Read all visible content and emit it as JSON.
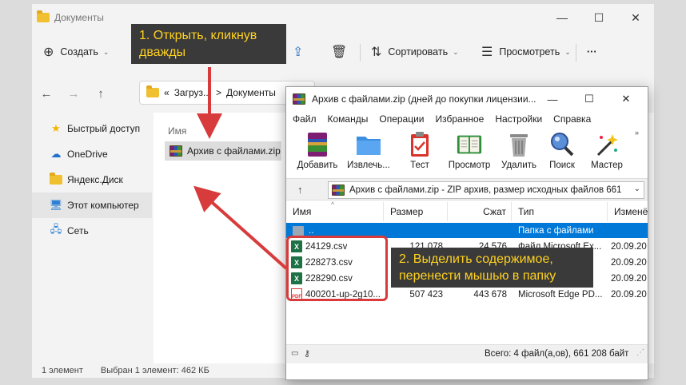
{
  "explorer": {
    "title": "Документы",
    "window_controls": {
      "minimize": "—",
      "maximize": "☐",
      "close": "✕"
    },
    "toolbar": {
      "new_label": "Создать",
      "sort_label": "Сортировать",
      "view_label": "Просмотреть",
      "more_label": "···"
    },
    "breadcrumb": {
      "prefix": "«",
      "part1": "Загруз...",
      "sep": ">",
      "part2": "Документы"
    },
    "sidebar": [
      {
        "label": "Быстрый доступ",
        "icon": "star-icon"
      },
      {
        "label": "OneDrive",
        "icon": "cloud-icon"
      },
      {
        "label": "Яндекс.Диск",
        "icon": "yandex-disk-icon"
      },
      {
        "label": "Этот компьютер",
        "icon": "computer-icon"
      },
      {
        "label": "Сеть",
        "icon": "network-icon"
      }
    ],
    "column_name": "Имя",
    "file_name": "Архив с файлами.zip",
    "status_count": "1 элемент",
    "status_selected": "Выбран 1 элемент: 462 КБ"
  },
  "winrar": {
    "title": "Архив с файлами.zip (дней до покупки лицензии...",
    "menu": [
      "Файл",
      "Команды",
      "Операции",
      "Избранное",
      "Настройки",
      "Справка"
    ],
    "tools": [
      {
        "label": "Добавить",
        "icon": "add-archive-icon"
      },
      {
        "label": "Извлечь...",
        "icon": "extract-icon"
      },
      {
        "label": "Тест",
        "icon": "test-icon"
      },
      {
        "label": "Просмотр",
        "icon": "view-book-icon"
      },
      {
        "label": "Удалить",
        "icon": "trash-icon"
      },
      {
        "label": "Поиск",
        "icon": "search-icon"
      },
      {
        "label": "Мастер",
        "icon": "wizard-icon"
      }
    ],
    "path_text": "Архив с файлами.zip - ZIP архив, размер исходных файлов 661",
    "columns": {
      "name": "Имя",
      "size": "Размер",
      "packed": "Сжат",
      "type": "Тип",
      "modified": "Изменё"
    },
    "rows": [
      {
        "name": "..",
        "size": "",
        "packed": "",
        "type": "Папка с файлами",
        "modified": ""
      },
      {
        "name": "24129.csv",
        "size": "121 078",
        "packed": "24 576",
        "type": "Файл Microsoft Ex...",
        "modified": "20.09.20"
      },
      {
        "name": "228273.csv",
        "size": "",
        "packed": "",
        "type": "...",
        "modified": "20.09.20"
      },
      {
        "name": "228290.csv",
        "size": "",
        "packed": "",
        "type": "...",
        "modified": "20.09.20"
      },
      {
        "name": "400201-up-2g10...",
        "size": "507 423",
        "packed": "443 678",
        "type": "Microsoft Edge PD...",
        "modified": "20.09.20"
      }
    ],
    "status_total": "Всего: 4 файл(а,ов), 661 208 байт"
  },
  "annotations": {
    "callout1_line1": "1. Открыть, кликнув",
    "callout1_line2": "дважды",
    "callout2_line1": "2. Выделить содержимое,",
    "callout2_line2": "перенести мышью в папку"
  },
  "colors": {
    "callout_bg": "#3a3a3a",
    "callout_text": "#ffd21f",
    "arrow_red": "#d83b3b",
    "selection_blue": "#0078d7"
  }
}
